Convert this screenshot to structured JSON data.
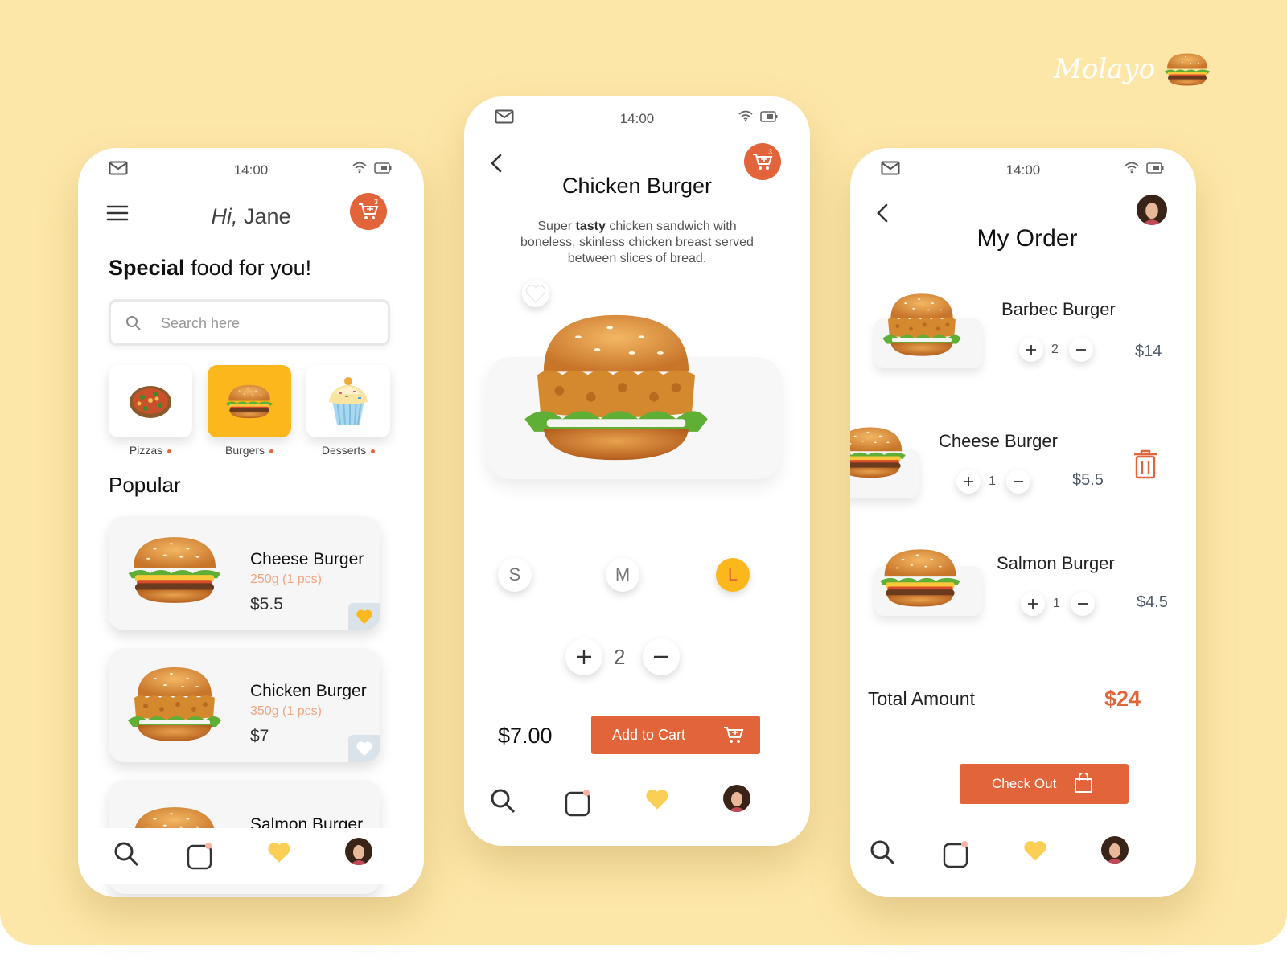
{
  "brand": {
    "name": "Molayo"
  },
  "colors": {
    "background": "#fde7a8",
    "accent": "#e1643a",
    "highlight": "#fbb71b"
  },
  "status_bar": {
    "time": "14:00"
  },
  "home": {
    "greeting_hi": "Hi,",
    "greeting_name": "Jane",
    "cart_count": "3",
    "headline_bold": "Special",
    "headline_rest": "food for you!",
    "search_placeholder": "Search here",
    "categories": [
      {
        "label": "Pizzas",
        "icon": "pizza-icon",
        "active": false
      },
      {
        "label": "Burgers",
        "icon": "burger-icon",
        "active": true
      },
      {
        "label": "Desserts",
        "icon": "cupcake-icon",
        "active": false
      }
    ],
    "popular_title": "Popular",
    "popular": [
      {
        "name": "Cheese Burger",
        "weight": "250g (1 pcs)",
        "price": "$5.5",
        "favorited": true
      },
      {
        "name": "Chicken Burger",
        "weight": "350g (1 pcs)",
        "price": "$7",
        "favorited": false
      },
      {
        "name": "Salmon Burger",
        "weight": "",
        "price": ""
      }
    ]
  },
  "detail": {
    "title": "Chicken Burger",
    "cart_count": "3",
    "description_pre": "Super ",
    "description_bold": "tasty",
    "description_post": " chicken sandwich with boneless, skinless chicken breast served between slices of bread.",
    "sizes": [
      "S",
      "M",
      "L"
    ],
    "selected_size": "L",
    "quantity": "2",
    "price": "$7.00",
    "add_to_cart_label": "Add to Cart"
  },
  "order": {
    "title": "My Order",
    "items": [
      {
        "name": "Barbec Burger",
        "quantity": "2",
        "price": "$14"
      },
      {
        "name": "Cheese Burger",
        "quantity": "1",
        "price": "$5.5"
      },
      {
        "name": "Salmon Burger",
        "quantity": "1",
        "price": "$4.5"
      }
    ],
    "total_label": "Total Amount",
    "total_value": "$24",
    "checkout_label": "Check Out"
  },
  "nav": [
    "search-icon",
    "bag-icon",
    "heart-icon",
    "profile-avatar"
  ]
}
